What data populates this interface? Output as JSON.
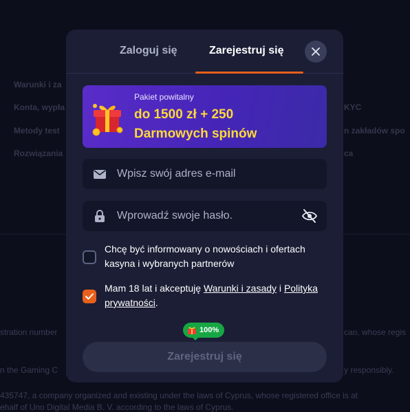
{
  "background": {
    "items": [
      "Warunki i za",
      "Konta, wypła",
      "Metody test",
      "Rozwiązania",
      "KYC",
      "n zakładów spo",
      "ca"
    ],
    "footer_lines": [
      "stration number",
      "cao, whose regis",
      "n the Gaming C",
      "y responsibly.",
      "435747, a company organized and existing under the laws of Cyprus, whose registered office is at",
      "ehalf of Uno Digital Media B. V. according to the laws of Cyprus."
    ]
  },
  "tabs": {
    "login": "Zaloguj się",
    "register": "Zarejestruj się"
  },
  "promo": {
    "subtitle": "Pakiet powitalny",
    "title_line1": "do 1500 zł + 250",
    "title_line2": "Darmowych spinów"
  },
  "form": {
    "email_placeholder": "Wpisz swój adres e-mail",
    "password_placeholder": "Wprowadź swoje hasło.",
    "newsletter_text": "Chcę być informowany o nowościach i ofertach kasyna i wybranych partnerów",
    "terms_prefix": "Mam 18 lat i akceptuję ",
    "terms_link": "Warunki i zasady",
    "terms_middle": " i ",
    "privacy_link": "Polityka prywatności",
    "terms_suffix": "."
  },
  "badge": {
    "percent": "100%"
  },
  "submit_label": "Zarejestruj się",
  "colors": {
    "accent": "#e8601c",
    "promo_text": "#ffd83a",
    "badge": "#17a644"
  }
}
